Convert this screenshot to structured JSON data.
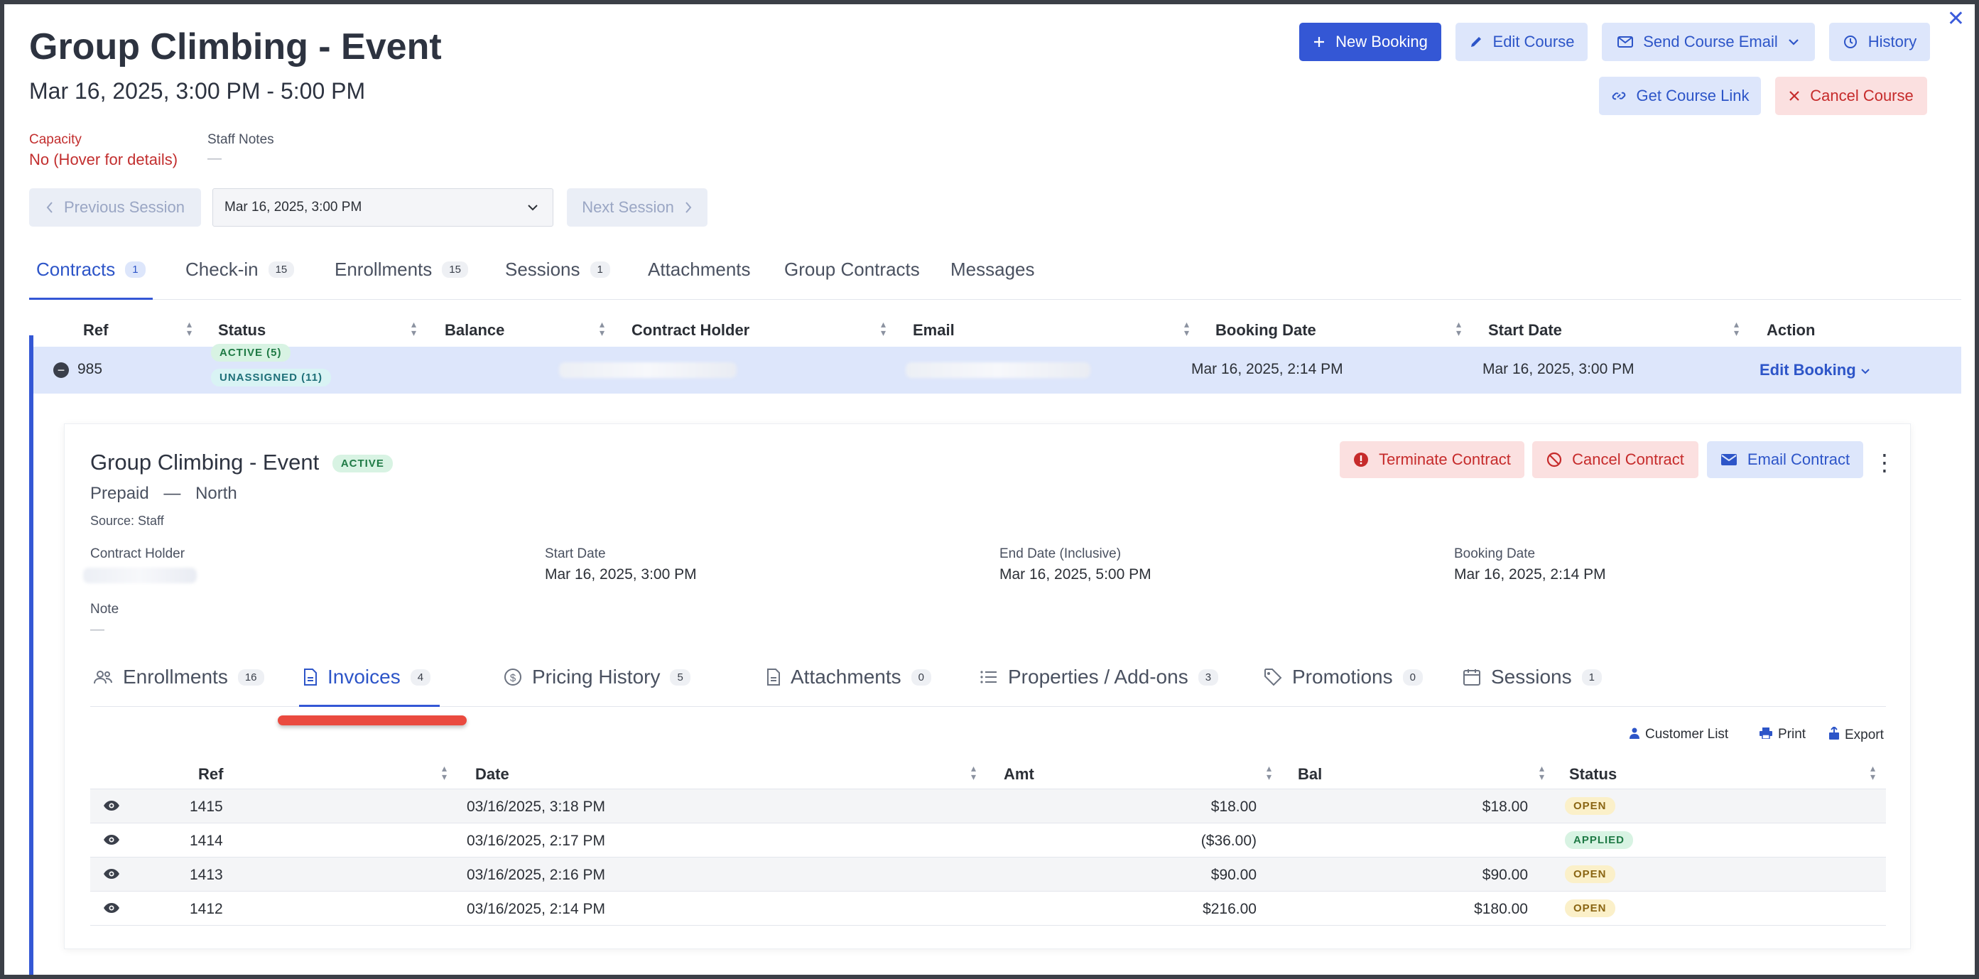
{
  "header": {
    "title": "Group Climbing - Event",
    "subtitle": "Mar 16, 2025, 3:00 PM - 5:00 PM",
    "close_icon": "✕"
  },
  "actions": {
    "new_booking": "New Booking",
    "edit_course": "Edit Course",
    "send_course_email": "Send Course Email",
    "history": "History",
    "get_course_link": "Get Course Link",
    "cancel_course": "Cancel Course"
  },
  "info": {
    "capacity_label": "Capacity",
    "capacity_value": "No (Hover for details)",
    "staff_notes_label": "Staff Notes",
    "staff_notes_value": "—"
  },
  "session_nav": {
    "previous": "Previous Session",
    "selected": "Mar 16, 2025, 3:00 PM",
    "next": "Next Session"
  },
  "tabs": [
    {
      "label": "Contracts",
      "count": "1"
    },
    {
      "label": "Check-in",
      "count": "15"
    },
    {
      "label": "Enrollments",
      "count": "15"
    },
    {
      "label": "Sessions",
      "count": "1"
    },
    {
      "label": "Attachments",
      "count": ""
    },
    {
      "label": "Group Contracts",
      "count": ""
    },
    {
      "label": "Messages",
      "count": ""
    }
  ],
  "contracts_table": {
    "headers": [
      "Ref",
      "Status",
      "Balance",
      "Contract Holder",
      "Email",
      "Booking Date",
      "Start Date",
      "Action"
    ],
    "row": {
      "ref": "985",
      "status_1": "ACTIVE (5)",
      "status_2": "UNASSIGNED (11)",
      "booking_date": "Mar 16, 2025, 2:14 PM",
      "start_date": "Mar 16, 2025, 3:00 PM",
      "action": "Edit Booking"
    }
  },
  "contract_card": {
    "title": "Group Climbing - Event",
    "status": "ACTIVE",
    "plan": "Prepaid",
    "separator": "—",
    "location": "North",
    "source": "Source: Staff",
    "terminate": "Terminate Contract",
    "cancel": "Cancel Contract",
    "email": "Email Contract",
    "fields": {
      "holder_label": "Contract Holder",
      "start_label": "Start Date",
      "start_value": "Mar 16, 2025, 3:00 PM",
      "end_label": "End Date (Inclusive)",
      "end_value": "Mar 16, 2025, 5:00 PM",
      "booking_label": "Booking Date",
      "booking_value": "Mar 16, 2025, 2:14 PM",
      "note_label": "Note",
      "note_value": "—"
    },
    "sub_tabs": [
      {
        "label": "Enrollments",
        "count": "16",
        "icon": "users-icon"
      },
      {
        "label": "Invoices",
        "count": "4",
        "icon": "document-icon"
      },
      {
        "label": "Pricing History",
        "count": "5",
        "icon": "dollar-icon"
      },
      {
        "label": "Attachments",
        "count": "0",
        "icon": "file-icon"
      },
      {
        "label": "Properties / Add-ons",
        "count": "3",
        "icon": "list-icon"
      },
      {
        "label": "Promotions",
        "count": "0",
        "icon": "tag-icon"
      },
      {
        "label": "Sessions",
        "count": "1",
        "icon": "calendar-icon"
      }
    ],
    "tools": {
      "customer_list": "Customer List",
      "print": "Print",
      "export": "Export"
    },
    "invoice_headers": [
      "Ref",
      "Date",
      "Amt",
      "Bal",
      "Status"
    ],
    "invoices": [
      {
        "ref": "1415",
        "date": "03/16/2025, 3:18 PM",
        "amt": "$18.00",
        "bal": "$18.00",
        "status": "OPEN"
      },
      {
        "ref": "1414",
        "date": "03/16/2025, 2:17 PM",
        "amt": "($36.00)",
        "bal": "",
        "status": "APPLIED"
      },
      {
        "ref": "1413",
        "date": "03/16/2025, 2:16 PM",
        "amt": "$90.00",
        "bal": "$90.00",
        "status": "OPEN"
      },
      {
        "ref": "1412",
        "date": "03/16/2025, 2:14 PM",
        "amt": "$216.00",
        "bal": "$180.00",
        "status": "OPEN"
      }
    ]
  }
}
